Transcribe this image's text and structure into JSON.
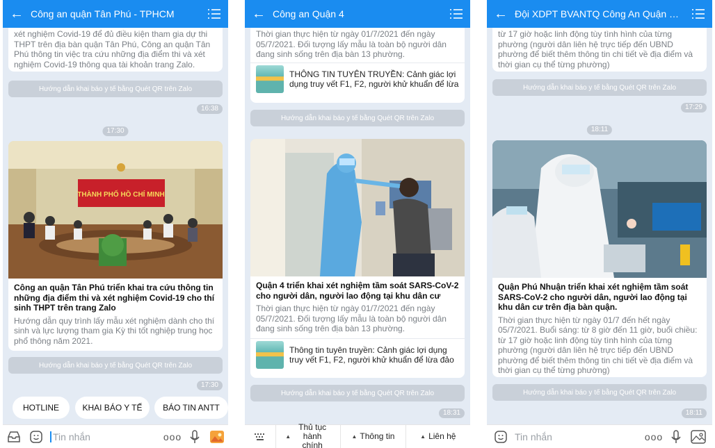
{
  "panel1": {
    "title": "Công an quận Tân Phú - TPHCM",
    "top_card_text": "xét nghiệm Covid-19 để đủ điều kiện tham gia dự thi THPT trên địa bàn quận Tân Phú, Công an quận Tân Phú thông tin việc tra cứu những địa điểm thi và xét nghiệm Covid-19 thông qua tài khoản trang Zalo.",
    "qr_label_1": "Hướng dẫn khai báo y tế bằng Quét QR trên Zalo",
    "time_1": "16:38",
    "time_center": "17:30",
    "article_title": "Công an quận Tân Phú triển khai tra cứu thông tin những địa điểm thi và xét nghiệm Covid-19 cho thí sinh THPT trên trang Zalo",
    "article_desc": "Hướng dẫn quy trình lấy mẫu xét nghiệm dành cho thí sinh và lực lượng tham gia Kỳ thi tốt nghiệp trung học phổ thông năm 2021.",
    "photo_banner": "THÀNH PHỐ HỒ CHÍ MINH",
    "qr_label_2": "Hướng dẫn khai báo y tế bằng Quét QR trên Zalo",
    "time_2": "17:30",
    "quick_buttons": [
      "HOTLINE",
      "KHAI BÁO Y TẾ",
      "BÁO TIN ANTT"
    ],
    "input_placeholder": "Tin nhắn",
    "dots": "ooo"
  },
  "panel2": {
    "title": "Công an Quận 4",
    "top_card_text": "Thời gian thực hiện từ ngày 01/7/2021 đến ngày 05/7/2021. Đối tượng lấy mẫu là toàn bộ người dân đang sinh sống trên địa bàn 13 phường.",
    "top_sub_text": "THÔNG TIN TUYÊN TRUYỀN: Cảnh giác lợi dụng truy vết F1, F2, người khử khuẩn để lừa",
    "qr_label_1": "Hướng dẫn khai báo y tế bằng Quét QR trên Zalo",
    "article_title": "Quận 4 triển khai xét nghiệm tầm soát SARS-CoV-2 cho người dân, người lao động tại khu dân cư",
    "article_desc": "Thời gian thực hiện từ ngày 01/7/2021 đến ngày 05/7/2021. Đối tượng lấy mẫu là toàn bộ người dân đang sinh sống trên địa bàn 13 phường.",
    "sub_text": "Thông tin tuyên truyền: Cảnh giác lợi dụng truy vết F1, F2, người khử khuẩn để lừa đảo",
    "qr_label_2": "Hướng dẫn khai báo y tế bằng Quét QR trên Zalo",
    "time": "18:31",
    "menu": {
      "item1": "Thủ tục hành chính",
      "item2": "Thông tin",
      "item3": "Liên hệ"
    }
  },
  "panel3": {
    "title": "Đội XDPT BVANTQ Công An Quận P...",
    "top_card_text": "từ 17 giờ hoặc linh động tùy tình hình của từng phường (người dân liên hệ trực tiếp đến UBND phường để biết thêm thông tin chi tiết về địa điểm và thời gian cụ thể từng phường)",
    "qr_label_1": "Hướng dẫn khai báo y tế bằng Quét QR trên Zalo",
    "time_1": "17:29",
    "time_center": "18:11",
    "article_title": "Quận Phú Nhuận triển khai xét nghiệm tầm soát SARS-CoV-2 cho người dân, người lao động tại khu dân cư trên địa bàn quận.",
    "article_desc": "Thời gian thực hiện từ ngày 01/7 đến hết ngày 05/7/2021. Buổi sáng: từ 8 giờ đến 11 giờ, buổi chiều: từ 17 giờ hoặc linh động tùy tình hình của từng phường (người dân liên hệ trực tiếp đến UBND phường để biết thêm thông tin chi tiết về địa điểm và thời gian cụ thể từng phường)",
    "qr_label_2": "Hướng dẫn khai báo y tế bằng Quét QR trên Zalo",
    "time_2": "18:11",
    "input_placeholder": "Tin nhắn",
    "dots": "ooo"
  },
  "colors": {
    "header": "#1a8cf0",
    "background": "#e4ebf4",
    "chip": "#c9d0d9"
  }
}
